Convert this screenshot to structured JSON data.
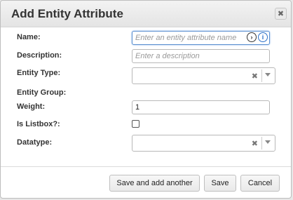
{
  "dialog": {
    "title": "Add Entity Attribute",
    "close_label": "✖"
  },
  "form": {
    "name": {
      "label": "Name:",
      "placeholder": "Enter an entity attribute name"
    },
    "description": {
      "label": "Description:",
      "placeholder": "Enter a description"
    },
    "entity_type": {
      "label": "Entity Type:",
      "value": ""
    },
    "entity_group": {
      "label": "Entity Group:"
    },
    "weight": {
      "label": "Weight:",
      "value": "1"
    },
    "is_listbox": {
      "label": "Is Listbox?:",
      "checked": false
    },
    "datatype": {
      "label": "Datatype:",
      "value": ""
    }
  },
  "icons": {
    "next": "›",
    "info": "i",
    "clear": "✖"
  },
  "buttons": {
    "save_and_add": "Save and add another",
    "save": "Save",
    "cancel": "Cancel"
  }
}
